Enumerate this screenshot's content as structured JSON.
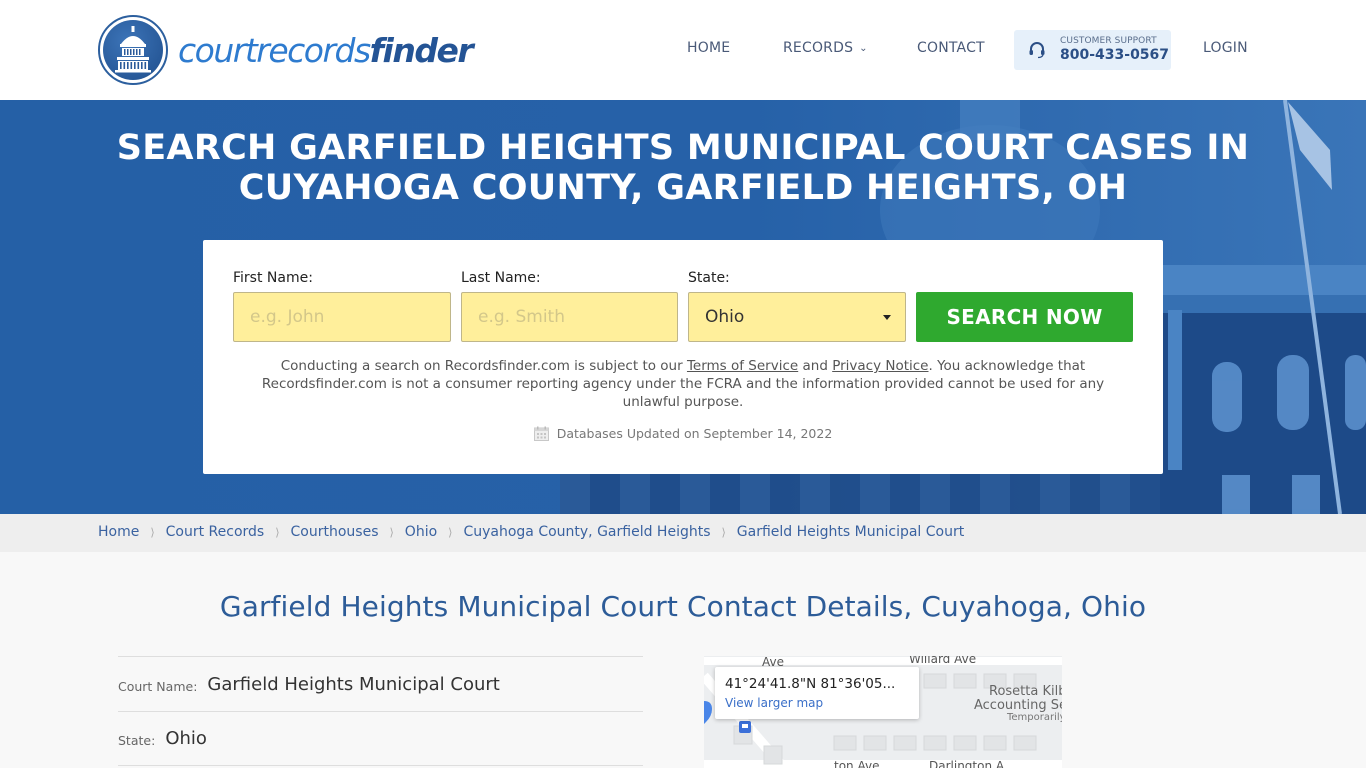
{
  "brand": {
    "name_light": "courtrecords",
    "name_bold": "finder"
  },
  "nav": {
    "home": "HOME",
    "records": "RECORDS",
    "contact": "CONTACT",
    "login": "LOGIN",
    "support_label": "CUSTOMER SUPPORT",
    "support_phone": "800-433-0567"
  },
  "hero": {
    "title_line1": "SEARCH GARFIELD HEIGHTS MUNICIPAL COURT CASES IN",
    "title_line2": "CUYAHOGA COUNTY, GARFIELD HEIGHTS, OH"
  },
  "search": {
    "first_name_label": "First Name:",
    "first_name_placeholder": "e.g. John",
    "last_name_label": "Last Name:",
    "last_name_placeholder": "e.g. Smith",
    "state_label": "State:",
    "state_value": "Ohio",
    "button_label": "SEARCH NOW",
    "disclaimer_part1": "Conducting a search on Recordsfinder.com is subject to our ",
    "terms_link": "Terms of Service",
    "disclaimer_and": " and ",
    "privacy_link": "Privacy Notice",
    "disclaimer_part2": ". You acknowledge that Recordsfinder.com is not a consumer reporting agency under the FCRA and the information provided cannot be used for any unlawful purpose.",
    "updated_text": "Databases Updated on September 14, 2022"
  },
  "breadcrumb": [
    "Home",
    "Court Records",
    "Courthouses",
    "Ohio",
    "Cuyahoga County, Garfield Heights",
    "Garfield Heights Municipal Court"
  ],
  "main": {
    "title": "Garfield Heights Municipal Court Contact Details, Cuyahoga, Ohio",
    "details": [
      {
        "label": "Court Name:",
        "value": "Garfield Heights Municipal Court"
      },
      {
        "label": "State:",
        "value": "Ohio"
      }
    ]
  },
  "map": {
    "coords": "41°24'41.8\"N 81°36'05...",
    "link": "View larger map",
    "street1": "Willard Ave",
    "street2": "Ave",
    "street3": "Darlington A",
    "street4": "ton Ave",
    "place_name1": "Rosetta Kilb",
    "place_name2": "Accounting Se",
    "place_status": "Temporarily"
  },
  "colors": {
    "brand_blue": "#2560a6",
    "accent_green": "#2fa92f",
    "input_yellow": "#ffef9b",
    "link_blue": "#3a62a0"
  }
}
